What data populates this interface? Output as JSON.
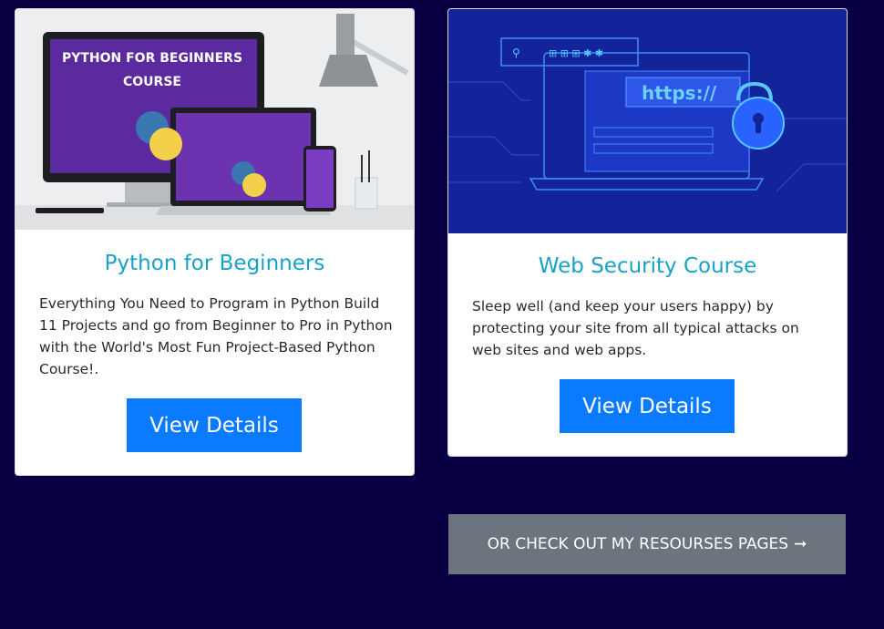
{
  "cards": [
    {
      "image_text_top": "PYTHON FOR BEGINNERS",
      "image_text_bottom": "COURSE",
      "title": "Python for Beginners",
      "description": "Everything You Need to Program in Python Build 11 Projects and go from Beginner to Pro in Python with the World's Most Fun Project-Based Python Course!.",
      "button_label": "View Details"
    },
    {
      "image_url_text": "https://",
      "title": "Web Security Course",
      "description": "Sleep well (and keep your users happy) by protecting your site from all typical attacks on web sites and web apps.",
      "button_label": "View Details"
    }
  ],
  "resources_button": {
    "label": "OR CHECK OUT MY RESOURSES PAGES",
    "arrow": "➞"
  },
  "colors": {
    "page_background": "#080042",
    "title_color": "#17a2c8",
    "primary_button": "#0a7bff",
    "secondary_button": "#6c757d"
  }
}
